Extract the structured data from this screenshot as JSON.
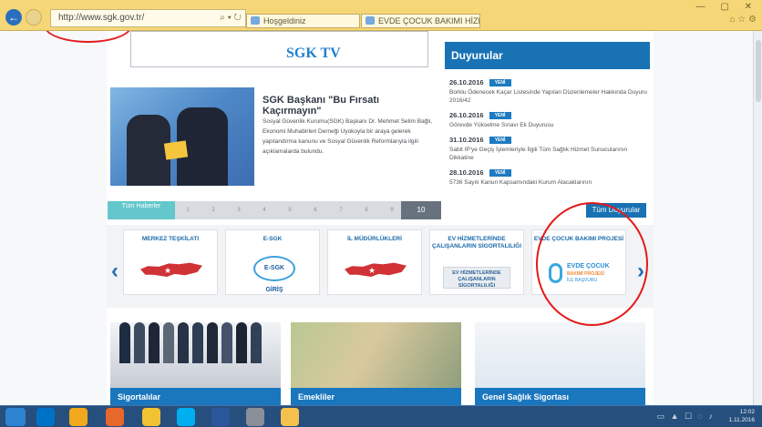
{
  "browser": {
    "url": "http://www.sgk.gov.tr/",
    "address_controls": "⌕ ▾ ↻",
    "tabs": [
      {
        "label": "Hoşgeldiniz"
      },
      {
        "label": "EVDE ÇOCUK BAKIMI HİZMETİ..."
      }
    ],
    "window_controls": "—  ▢  ✕",
    "tools": "⌂ ☆ ⚙"
  },
  "page": {
    "sgk_tv": "SGK TV",
    "announcements_title": "Duyurular",
    "news_title": "SGK Başkanı \"Bu Fırsatı Kaçırmayın\"",
    "news_body": "Sosyal Güvenlik Kurumu(SGK) Başkanı Dr. Mehmet Selim Bağlı, Ekonomi Muhabirleri Derneği Uyokoyla bir araya gelerek yapılandırma kanunu ve Sosyal Güvenlik Reformlarıyla ilgili açıklamalarda bulundu.",
    "slider": {
      "first": "Tüm Haberler",
      "numbers": [
        "1",
        "2",
        "3",
        "4",
        "5",
        "6",
        "7",
        "8",
        "9"
      ],
      "last": "10"
    },
    "announcements": [
      {
        "date": "26.10.2016",
        "tag": "YENİ",
        "text": "Borklu Ödenecek Kaçar Listesinde Yapılan Düzenlemeler Hakkında Duyuru 2016/42"
      },
      {
        "date": "26.10.2016",
        "tag": "YENİ",
        "text": "Görevde Yükselme Sınavı Ek Duyurusu"
      },
      {
        "date": "31.10.2016",
        "tag": "YENİ",
        "text": "Sabit IP'ye Geçiş İşlemleriyle İlgili Tüm Sağlık Hizmet Sunucularının Dikkatine"
      },
      {
        "date": "28.10.2016",
        "tag": "YENİ",
        "text": "5736 Sayılı Kanun Kapsamındaki Kurum Alacaklarının"
      }
    ],
    "all_announcements": "Tüm Duyurular",
    "carousel": {
      "prev": "‹",
      "next": "›",
      "items": [
        {
          "title": "MERKEZ TEŞKİLATI"
        },
        {
          "title": "E-SGK",
          "logo": "E-SGK GİRİŞ"
        },
        {
          "title": "İL MÜDÜRLÜKLERİ"
        },
        {
          "title": "EV HİZMETLERİNDE ÇALIŞANLARIN SİGORTALILIĞI",
          "logo": "EV HİZMETLERİNDE ÇALIŞANLARIN SİGORTALILIĞI"
        },
        {
          "title": "EVDE ÇOCUK BAKIMI PROJESİ",
          "logo_title": "EVDE ÇOCUK",
          "logo_sub": "BAKIMI PROJESİ",
          "logo_sub2": "İLE BAŞVURU"
        }
      ]
    },
    "bottom_cards": [
      {
        "label": "Sigortalılar"
      },
      {
        "label": "Emekliler"
      },
      {
        "label": "Genel Sağlık Sigortası"
      }
    ]
  },
  "taskbar": {
    "time": "12:02",
    "date": "1.11.2016",
    "tray_icons": "▭ ▲ ☐ ◌ ♪"
  },
  "colors": {
    "brand": "#1872b4",
    "annotation": "#e31a1a"
  }
}
